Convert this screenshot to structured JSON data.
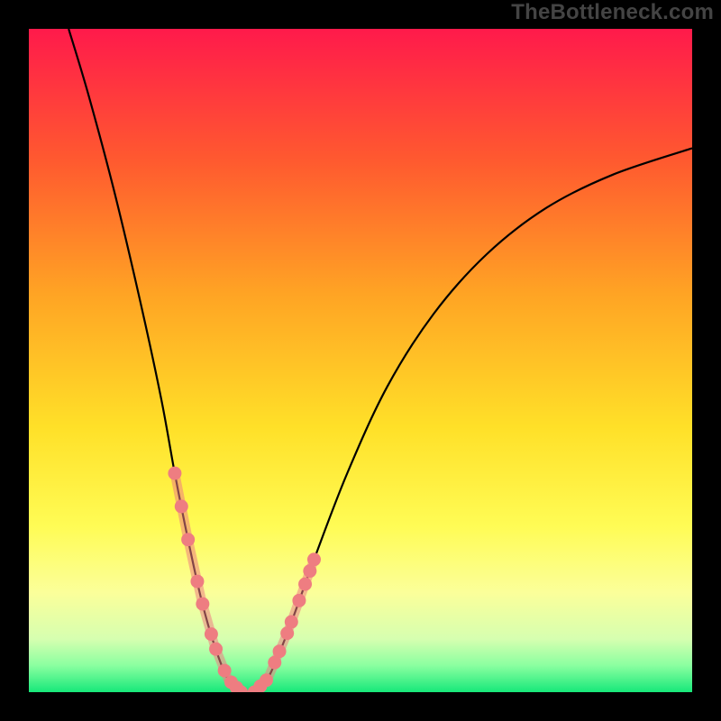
{
  "watermark": "TheBottleneck.com",
  "chart_data": {
    "type": "line",
    "title": "",
    "xlabel": "",
    "ylabel": "",
    "xlim": [
      0,
      100
    ],
    "ylim": [
      0,
      100
    ],
    "background_gradient_stops": [
      {
        "offset": 0,
        "color": "#ff1a4b"
      },
      {
        "offset": 20,
        "color": "#ff5a2f"
      },
      {
        "offset": 40,
        "color": "#ffa424"
      },
      {
        "offset": 60,
        "color": "#ffe028"
      },
      {
        "offset": 75,
        "color": "#fffc55"
      },
      {
        "offset": 85,
        "color": "#fbff9a"
      },
      {
        "offset": 92,
        "color": "#d6ffb0"
      },
      {
        "offset": 96,
        "color": "#8affa0"
      },
      {
        "offset": 100,
        "color": "#17e87a"
      }
    ],
    "series": [
      {
        "name": "left-curve",
        "stroke": "#000000",
        "points": [
          {
            "x": 6,
            "y": 100
          },
          {
            "x": 9,
            "y": 90
          },
          {
            "x": 13,
            "y": 75
          },
          {
            "x": 17,
            "y": 58
          },
          {
            "x": 20,
            "y": 44
          },
          {
            "x": 22,
            "y": 33
          },
          {
            "x": 24,
            "y": 23
          },
          {
            "x": 26,
            "y": 14
          },
          {
            "x": 28,
            "y": 7
          },
          {
            "x": 30,
            "y": 2
          },
          {
            "x": 32,
            "y": 0
          }
        ]
      },
      {
        "name": "right-curve",
        "stroke": "#000000",
        "points": [
          {
            "x": 34,
            "y": 0
          },
          {
            "x": 36,
            "y": 2
          },
          {
            "x": 39,
            "y": 9
          },
          {
            "x": 43,
            "y": 20
          },
          {
            "x": 48,
            "y": 33
          },
          {
            "x": 54,
            "y": 46
          },
          {
            "x": 61,
            "y": 57
          },
          {
            "x": 69,
            "y": 66
          },
          {
            "x": 78,
            "y": 73
          },
          {
            "x": 88,
            "y": 78
          },
          {
            "x": 100,
            "y": 82
          }
        ]
      }
    ],
    "highlight_segments": [
      {
        "curve": "left",
        "x_from": 22,
        "x_to": 32
      },
      {
        "curve": "right",
        "x_from": 34,
        "x_to": 43
      }
    ],
    "highlight_color": "#ee7d81"
  }
}
